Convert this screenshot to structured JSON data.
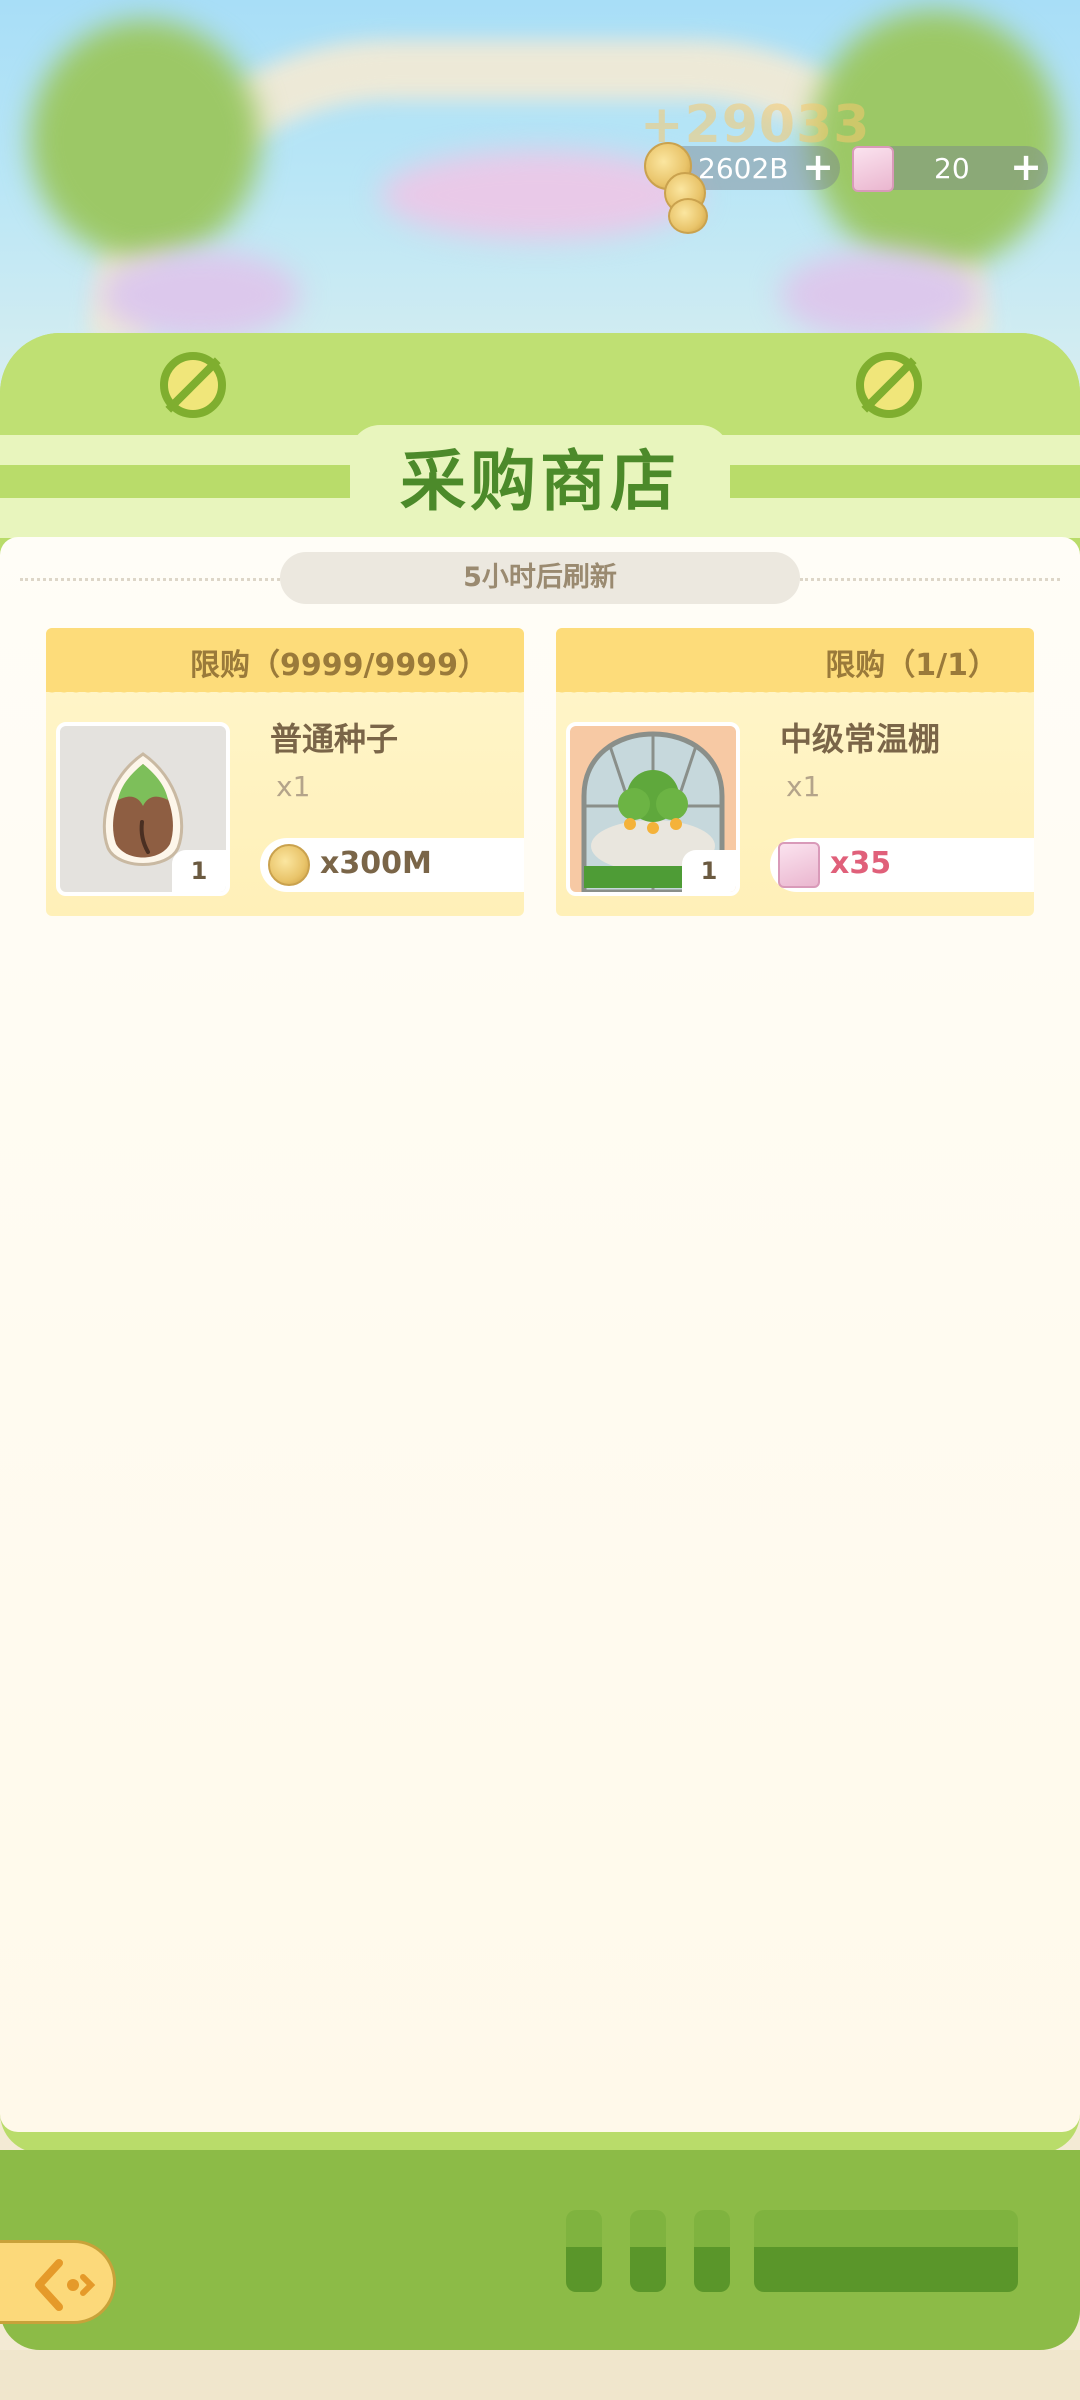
{
  "currency": {
    "gain_popup": "+29033",
    "coins_value": "2602B",
    "tickets_value": "20",
    "add_symbol": "+"
  },
  "shop": {
    "title": "采购商店",
    "refresh_text": "5小时后刷新",
    "items": [
      {
        "limit": "限购（9999/9999）",
        "name": "普通种子",
        "count": "x1",
        "stack": "1",
        "price": "x300M",
        "price_currency_icon": "coin-icon",
        "price_color": "#7a6548"
      },
      {
        "limit": "限购（1/1）",
        "name": "中级常温棚",
        "count": "x1",
        "stack": "1",
        "price": "x35",
        "price_currency_icon": "ticket-icon",
        "price_color": "#e0607a"
      }
    ]
  },
  "colors": {
    "panel_green": "#b9dc6a",
    "title_green": "#4c8a2a",
    "card_header": "#fddc7a",
    "bottom_bar": "#8cbb47"
  }
}
